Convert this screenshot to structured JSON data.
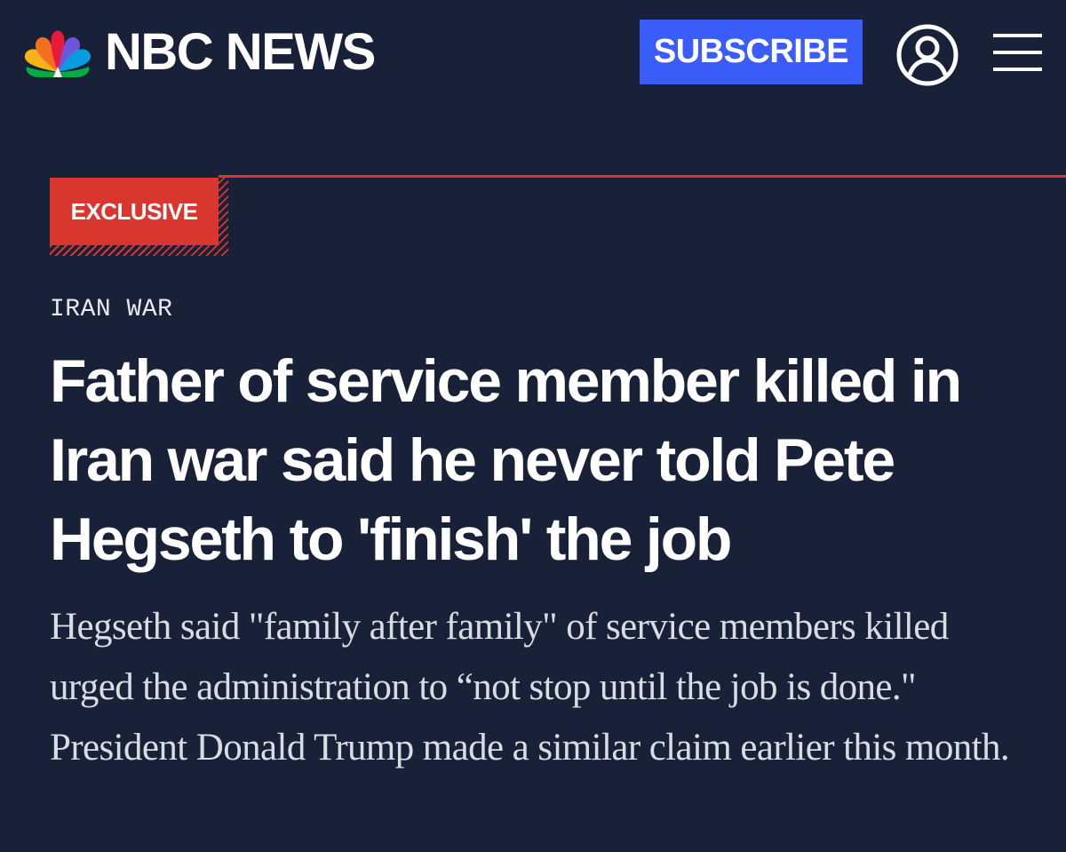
{
  "header": {
    "brand_name": "NBC NEWS",
    "subscribe_label": "SUBSCRIBE",
    "icons": {
      "logo": "nbc-peacock-icon",
      "account": "user-account-icon",
      "menu": "hamburger-menu-icon"
    }
  },
  "article": {
    "badge": "EXCLUSIVE",
    "section": "IRAN WAR",
    "headline": "Father of service member killed in Iran war said he never told Pete Hegseth to 'finish' the job",
    "dek": "Hegseth said \"family after family\" of service members killed urged the administration to “not stop until the job is done.\" President Donald Trump made a similar claim earlier this month."
  },
  "colors": {
    "background": "#182138",
    "subscribe_button": "#3a5dfa",
    "accent_red": "#d8362e",
    "headline_text": "#ffffff",
    "dek_text": "#d9dce3"
  }
}
